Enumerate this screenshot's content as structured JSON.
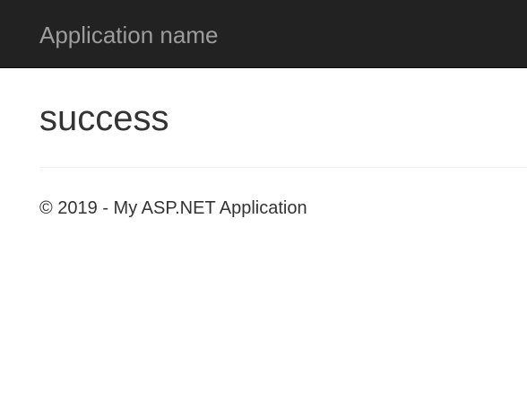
{
  "navbar": {
    "brand_label": "Application name"
  },
  "main": {
    "title": "success"
  },
  "footer": {
    "text": "© 2019 - My ASP.NET Application"
  },
  "colors": {
    "navbar_background": "#222222",
    "brand_text": "#9d9d9d",
    "body_text": "#333333",
    "divider": "#eeeeee"
  }
}
